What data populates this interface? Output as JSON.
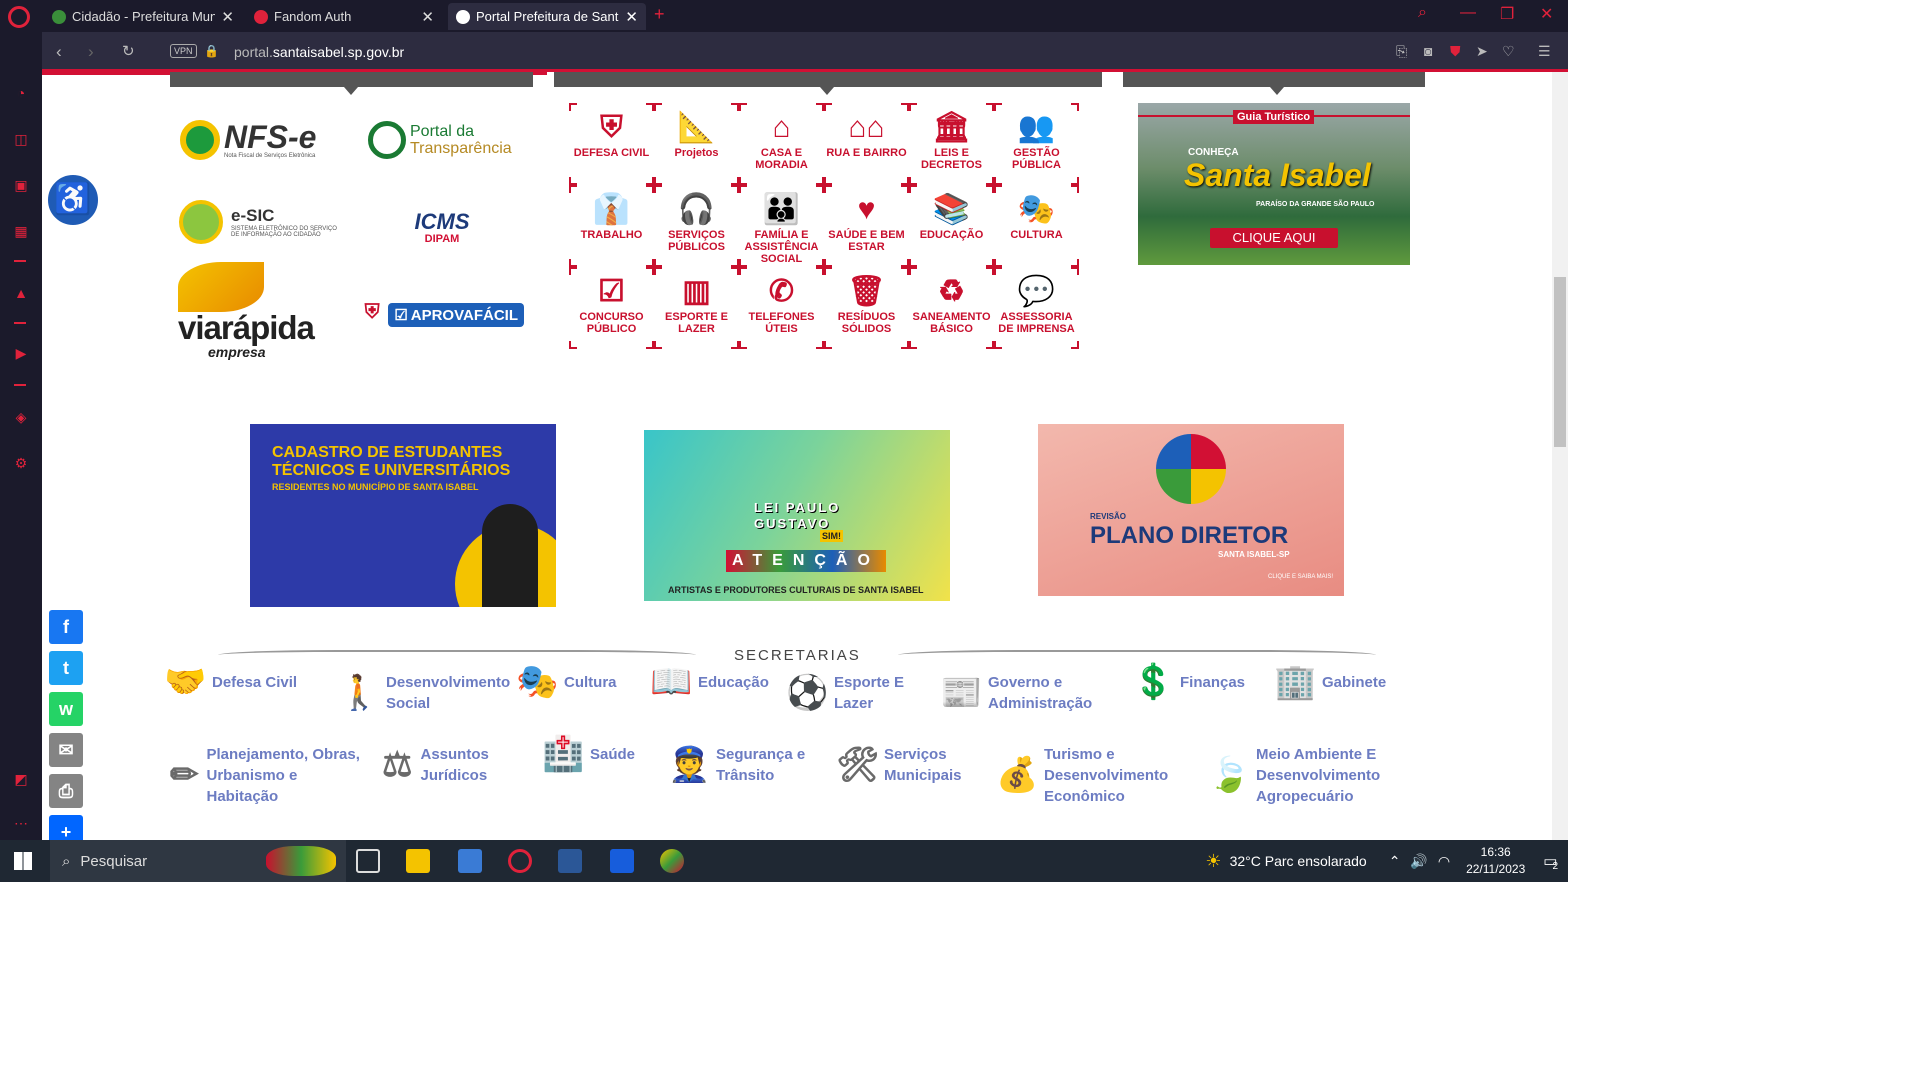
{
  "browser": {
    "tabs": [
      {
        "label": "Cidadão - Prefeitura Munic",
        "icon_color": "#3a8f3a"
      },
      {
        "label": "Fandom Auth",
        "icon_color": "#e0223b"
      },
      {
        "label": "Portal Prefeitura de Santa I",
        "icon_color": "#ffffff"
      }
    ],
    "new_tab": "+",
    "close_glyph": "✕",
    "vpn": "VPN",
    "url_prefix": "portal.",
    "url_host": "santaisabel.sp.gov.br",
    "accent": "#e0223b"
  },
  "logos": {
    "nfse": "NFS-e",
    "nfse_sub": "Nota Fiscal de Serviços Eletrônica",
    "transparencia_1": "Portal da",
    "transparencia_2": "Transparência",
    "esic": "e-SIC",
    "esic_sub": "SISTEMA ELETRÔNICO DO SERVIÇO DE INFORMAÇÃO AO CIDADÃO",
    "icms": "ICMS",
    "dipam": "DIPAM",
    "viarapida": "viarápida",
    "viarapida_sub": "empresa",
    "aprova": "APROVAFÁCIL"
  },
  "services": [
    {
      "label": "DEFESA CIVIL",
      "icon": "shield-icon",
      "glyph": "⛨"
    },
    {
      "label": "Projetos",
      "icon": "ruler-icon",
      "glyph": "📐"
    },
    {
      "label": "CASA E MORADIA",
      "icon": "house-icon",
      "glyph": "⌂"
    },
    {
      "label": "RUA E BAIRRO",
      "icon": "houses-icon",
      "glyph": "⌂⌂"
    },
    {
      "label": "LEIS E DECRETOS",
      "icon": "columns-icon",
      "glyph": "🏛"
    },
    {
      "label": "GESTÃO PÚBLICA",
      "icon": "people-icon",
      "glyph": "👥"
    },
    {
      "label": "TRABALHO",
      "icon": "worker-icon",
      "glyph": "👔"
    },
    {
      "label": "SERVIÇOS PÚBLICOS",
      "icon": "headset-icon",
      "glyph": "🎧"
    },
    {
      "label": "FAMÍLIA E ASSISTÊNCIA SOCIAL",
      "icon": "family-icon",
      "glyph": "👪"
    },
    {
      "label": "SAÚDE E BEM ESTAR",
      "icon": "heart-icon",
      "glyph": "♥"
    },
    {
      "label": "EDUCAÇÃO",
      "icon": "books-icon",
      "glyph": "📚"
    },
    {
      "label": "CULTURA",
      "icon": "theater-masks-icon",
      "glyph": "🎭"
    },
    {
      "label": "CONCURSO PÚBLICO",
      "icon": "checklist-icon",
      "glyph": "☑"
    },
    {
      "label": "ESPORTE E LAZER",
      "icon": "field-icon",
      "glyph": "▥"
    },
    {
      "label": "TELEFONES ÚTEIS",
      "icon": "phone-icon",
      "glyph": "✆"
    },
    {
      "label": "RESÍDUOS SÓLIDOS",
      "icon": "trash-icon",
      "glyph": "🗑"
    },
    {
      "label": "SANEAMENTO BÁSICO",
      "icon": "sanitation-icon",
      "glyph": "♻"
    },
    {
      "label": "ASSESSORIA DE IMPRENSA",
      "icon": "speech-bubbles-icon",
      "glyph": "💬"
    }
  ],
  "tourism": {
    "tag": "Guia Turístico",
    "conheca": "CONHEÇA",
    "title": "Santa Isabel",
    "subtitle": "PARAÍSO DA GRANDE SÃO PAULO",
    "cta": "CLIQUE AQUI"
  },
  "banners": {
    "students_1": "CADASTRO DE ESTUDANTES",
    "students_2": "TÉCNICOS E UNIVERSITÁRIOS",
    "students_3": "RESIDENTES NO MUNICÍPIO DE SANTA ISABEL",
    "paulo_1": "LEI PAULO",
    "paulo_2": "GUSTAVO",
    "paulo_3": "SIM!",
    "atencao": "ATENÇÃO",
    "paulo_footer": "ARTISTAS E PRODUTORES CULTURAIS DE SANTA ISABEL",
    "plano_small": "REVISÃO",
    "plano_title": "PLANO DIRETOR",
    "plano_city": "SANTA ISABEL-SP",
    "plano_cta": "CLIQUE E SAIBA MAIS!"
  },
  "secretarias_title": "SECRETARIAS",
  "secretarias": [
    {
      "label": "Defesa Civil",
      "icon": "handshake-icon",
      "glyph": "🤝"
    },
    {
      "label": "Desenvolvimento Social",
      "icon": "person-icon",
      "glyph": "🚶"
    },
    {
      "label": "Cultura",
      "icon": "theater-masks-icon",
      "glyph": "🎭"
    },
    {
      "label": "Educação",
      "icon": "book-reader-icon",
      "glyph": "📖"
    },
    {
      "label": "Esporte E Lazer",
      "icon": "soccer-ball-icon",
      "glyph": "⚽"
    },
    {
      "label": "Governo e Administração",
      "icon": "newspaper-icon",
      "glyph": "📰"
    },
    {
      "label": "Finanças",
      "icon": "dollar-file-icon",
      "glyph": "💲"
    },
    {
      "label": "Gabinete",
      "icon": "building-icon",
      "glyph": "🏢"
    },
    {
      "label": "Planejamento, Obras, Urbanismo e Habitação",
      "icon": "pencil-ruler-icon",
      "glyph": "✏"
    },
    {
      "label": "Assuntos Jurídicos",
      "icon": "scales-icon",
      "glyph": "⚖"
    },
    {
      "label": "Saúde",
      "icon": "clinic-icon",
      "glyph": "🏥"
    },
    {
      "label": "Segurança e Trânsito",
      "icon": "user-shield-icon",
      "glyph": "👮"
    },
    {
      "label": "Serviços Municipais",
      "icon": "tools-icon",
      "glyph": "🛠"
    },
    {
      "label": "Turismo e Desenvolvimento Econômico",
      "icon": "hand-money-icon",
      "glyph": "💰"
    },
    {
      "label": "Meio Ambiente E Desenvolvimento Agropecuário",
      "icon": "leaf-icon",
      "glyph": "🍃"
    }
  ],
  "share": [
    {
      "name": "facebook",
      "glyph": "f",
      "color": "#1877f2"
    },
    {
      "name": "twitter",
      "glyph": "t",
      "color": "#1da1f2"
    },
    {
      "name": "whatsapp",
      "glyph": "w",
      "color": "#25d366"
    },
    {
      "name": "email",
      "glyph": "✉",
      "color": "#848484"
    },
    {
      "name": "print",
      "glyph": "⎙",
      "color": "#848484"
    },
    {
      "name": "share",
      "glyph": "+",
      "color": "#0166ff"
    }
  ],
  "taskbar": {
    "search_placeholder": "Pesquisar",
    "weather": "32°C  Parc ensolarado",
    "time": "16:36",
    "date": "22/11/2023",
    "notifications": "2"
  }
}
